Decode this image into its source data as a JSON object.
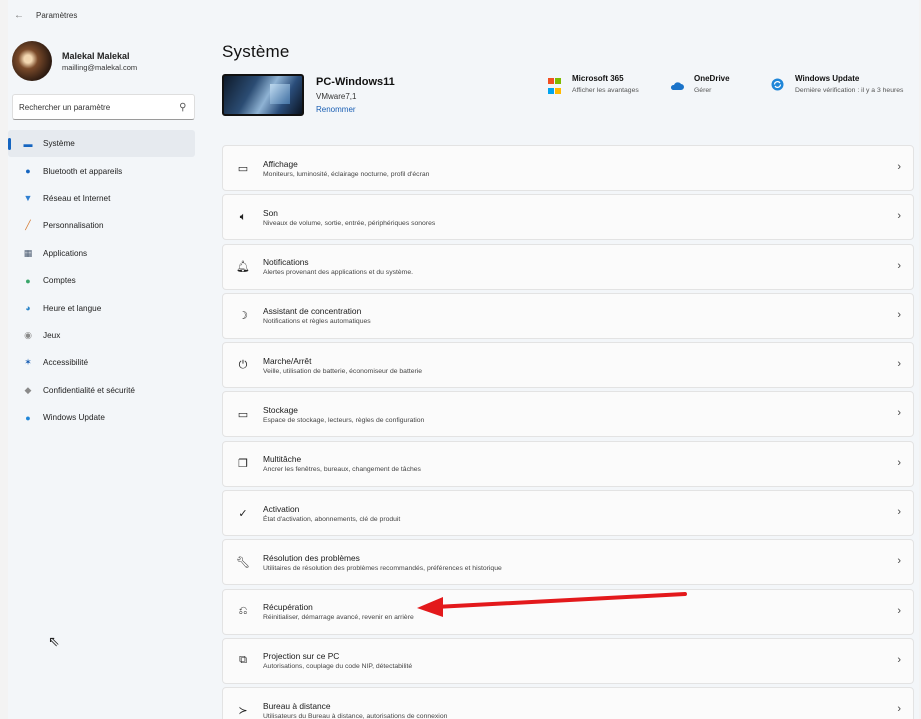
{
  "window": {
    "title": "Paramètres",
    "back_glyph": "←"
  },
  "user": {
    "name": "Malekal Malekal",
    "email": "mailling@malekal.com"
  },
  "search": {
    "placeholder": "Rechercher un paramètre",
    "icon": "search-icon"
  },
  "sidebar": {
    "items": [
      {
        "label": "Système",
        "icon": "system-icon",
        "glyph": "▬",
        "color": "#1565c0",
        "active": true
      },
      {
        "label": "Bluetooth et appareils",
        "icon": "bluetooth-icon",
        "glyph": "●",
        "color": "#1565c0"
      },
      {
        "label": "Réseau et Internet",
        "icon": "network-icon",
        "glyph": "▼",
        "color": "#2f7fd1"
      },
      {
        "label": "Personnalisation",
        "icon": "brush-icon",
        "glyph": "╱",
        "color": "#d4762c"
      },
      {
        "label": "Applications",
        "icon": "apps-icon",
        "glyph": "▦",
        "color": "#4a5a70"
      },
      {
        "label": "Comptes",
        "icon": "account-icon",
        "glyph": "●",
        "color": "#3aa66a"
      },
      {
        "label": "Heure et langue",
        "icon": "clock-globe-icon",
        "glyph": "◕",
        "color": "#2a84c8"
      },
      {
        "label": "Jeux",
        "icon": "gamepad-icon",
        "glyph": "◉",
        "color": "#8a8a8a"
      },
      {
        "label": "Accessibilité",
        "icon": "accessibility-icon",
        "glyph": "✶",
        "color": "#1a5fb4"
      },
      {
        "label": "Confidentialité et sécurité",
        "icon": "shield-icon",
        "glyph": "◆",
        "color": "#8a8a8a"
      },
      {
        "label": "Windows Update",
        "icon": "update-icon",
        "glyph": "●",
        "color": "#1f86d8"
      }
    ]
  },
  "main": {
    "title": "Système",
    "pc": {
      "name": "PC-Windows11",
      "model": "VMware7,1",
      "rename_label": "Renommer"
    },
    "services": {
      "ms365": {
        "title": "Microsoft 365",
        "subtitle": "Afficher les avantages"
      },
      "onedrive": {
        "title": "OneDrive",
        "subtitle": "Gérer"
      },
      "windows_update": {
        "title": "Windows Update",
        "subtitle": "Dernière vérification : il y a 3 heures"
      }
    },
    "cards": [
      {
        "title": "Affichage",
        "subtitle": "Moniteurs, luminosité, éclairage nocturne, profil d'écran",
        "icon": "monitor-icon",
        "glyph": "▭"
      },
      {
        "title": "Son",
        "subtitle": "Niveaux de volume, sortie, entrée, périphériques sonores",
        "icon": "speaker-icon",
        "glyph": "🔈︎"
      },
      {
        "title": "Notifications",
        "subtitle": "Alertes provenant des applications et du système.",
        "icon": "bell-icon",
        "glyph": "🔔︎"
      },
      {
        "title": "Assistant de concentration",
        "subtitle": "Notifications et règles automatiques",
        "icon": "moon-icon",
        "glyph": "☽"
      },
      {
        "title": "Marche/Arrêt",
        "subtitle": "Veille, utilisation de batterie, économiseur de batterie",
        "icon": "power-icon",
        "glyph": "⏻"
      },
      {
        "title": "Stockage",
        "subtitle": "Espace de stockage, lecteurs, règles de configuration",
        "icon": "storage-icon",
        "glyph": "▭"
      },
      {
        "title": "Multitâche",
        "subtitle": "Ancrer les fenêtres, bureaux, changement de tâches",
        "icon": "multitask-icon",
        "glyph": "❐"
      },
      {
        "title": "Activation",
        "subtitle": "État d'activation, abonnements, clé de produit",
        "icon": "check-circle-icon",
        "glyph": "✓"
      },
      {
        "title": "Résolution des problèmes",
        "subtitle": "Utilitaires de résolution des problèmes recommandés, préférences et historique",
        "icon": "wrench-icon",
        "glyph": "🔧︎"
      },
      {
        "title": "Récupération",
        "subtitle": "Réinitialiser, démarrage avancé, revenir en arrière",
        "icon": "recovery-icon",
        "glyph": "⎌"
      },
      {
        "title": "Projection sur ce PC",
        "subtitle": "Autorisations, couplage du code NIP, détectabilité",
        "icon": "projection-icon",
        "glyph": "⧉"
      },
      {
        "title": "Bureau à distance",
        "subtitle": "Utilisateurs du Bureau à distance, autorisations de connexion",
        "icon": "remote-desktop-icon",
        "glyph": "≻"
      }
    ],
    "chevron": "›"
  },
  "colors": {
    "accent": "#1565c0",
    "arrow": "#e3191b"
  }
}
